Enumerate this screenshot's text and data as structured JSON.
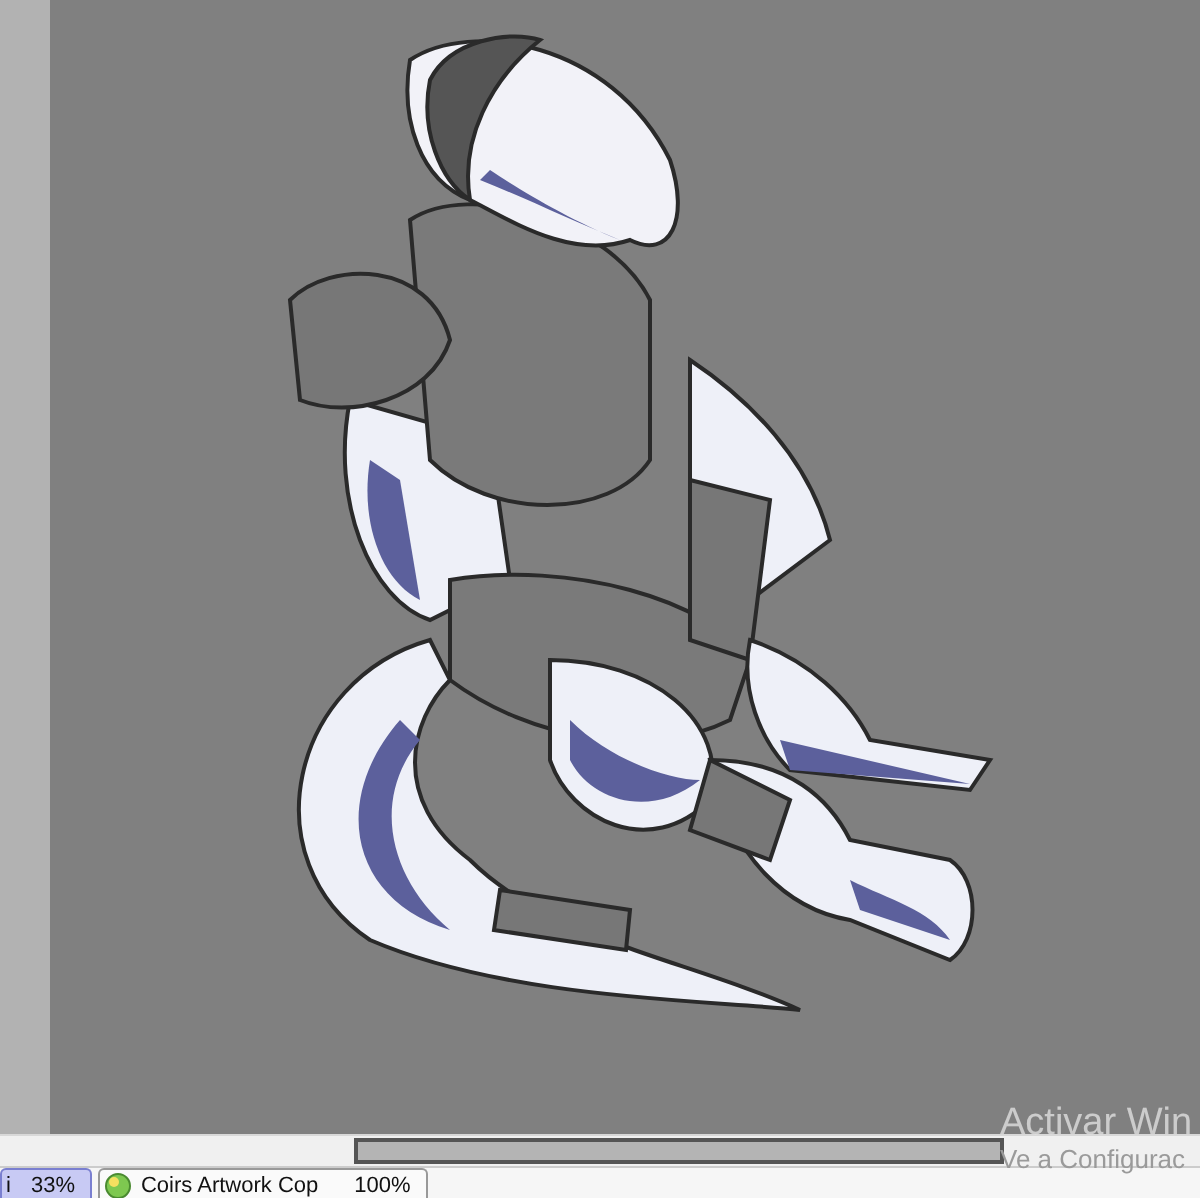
{
  "document_tabs": [
    {
      "label": "i",
      "zoom": "33%",
      "selected": true
    },
    {
      "label": "Coirs Artwork Cop",
      "zoom": "100%",
      "selected": false
    }
  ],
  "activation_notice": {
    "title": "Activar Win",
    "subtitle": "Ve a Configurac"
  }
}
